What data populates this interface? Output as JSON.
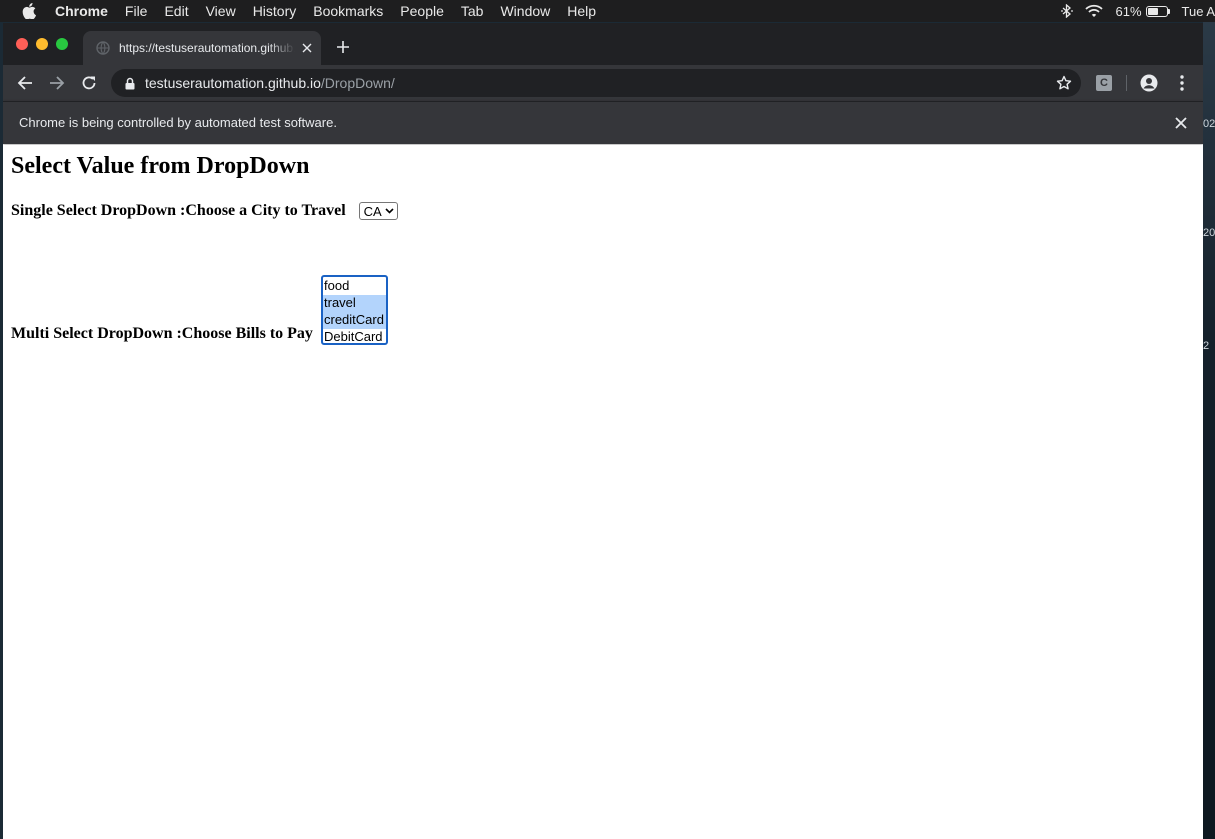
{
  "menubar": {
    "app_name": "Chrome",
    "items": [
      "File",
      "Edit",
      "View",
      "History",
      "Bookmarks",
      "People",
      "Tab",
      "Window",
      "Help"
    ],
    "battery_percent": "61%",
    "battery_level": 0.61,
    "clock": "Tue A"
  },
  "desktop_clock_fragments": [
    "02",
    "20",
    "2"
  ],
  "browser": {
    "tab_title": "https://testuserautomation.github.io/DropDown/",
    "url_host": "testuserautomation.github.io",
    "url_path": "/DropDown/",
    "extension_label": "C",
    "infobar_message": "Chrome is being controlled by automated test software."
  },
  "page": {
    "heading": "Select Value from DropDown",
    "single_label": "Single Select DropDown :Choose a City to Travel",
    "single_value": "CA",
    "multi_label": "Multi Select DropDown :Choose Bills to Pay",
    "multi_options": [
      {
        "label": "food",
        "selected": false
      },
      {
        "label": "travel",
        "selected": true
      },
      {
        "label": "creditCard",
        "selected": true
      },
      {
        "label": "DebitCard",
        "selected": false
      }
    ]
  },
  "colors": {
    "selected_option_bg": "#b3d4fc",
    "focus_ring": "#1a62c4"
  }
}
